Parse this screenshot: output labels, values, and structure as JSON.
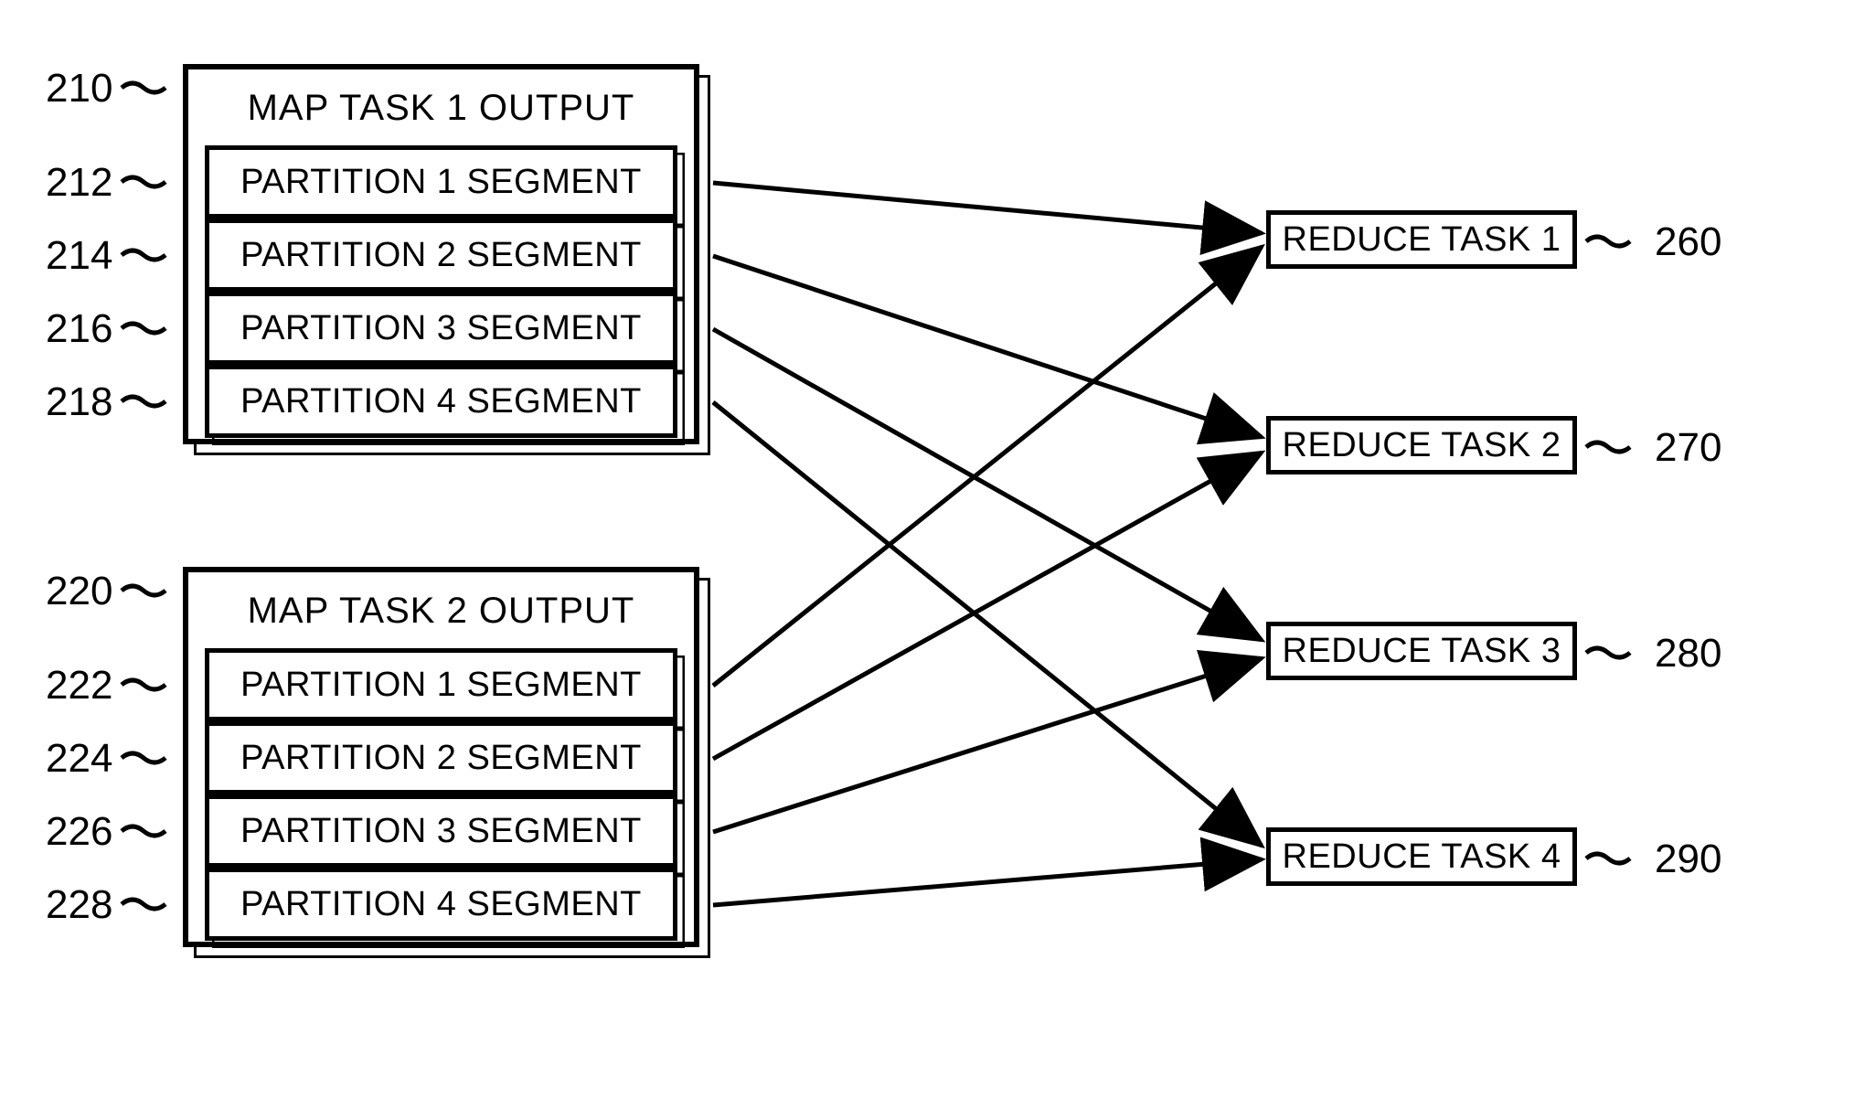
{
  "map_outputs": [
    {
      "title": "MAP TASK 1 OUTPUT",
      "ref": "210",
      "partitions": [
        {
          "label": "PARTITION 1 SEGMENT",
          "ref": "212"
        },
        {
          "label": "PARTITION 2 SEGMENT",
          "ref": "214"
        },
        {
          "label": "PARTITION 3 SEGMENT",
          "ref": "216"
        },
        {
          "label": "PARTITION 4 SEGMENT",
          "ref": "218"
        }
      ]
    },
    {
      "title": "MAP TASK 2 OUTPUT",
      "ref": "220",
      "partitions": [
        {
          "label": "PARTITION 1 SEGMENT",
          "ref": "222"
        },
        {
          "label": "PARTITION 2 SEGMENT",
          "ref": "224"
        },
        {
          "label": "PARTITION 3 SEGMENT",
          "ref": "226"
        },
        {
          "label": "PARTITION 4 SEGMENT",
          "ref": "228"
        }
      ]
    }
  ],
  "reduce_tasks": [
    {
      "label": "REDUCE TASK 1",
      "ref": "260"
    },
    {
      "label": "REDUCE TASK 2",
      "ref": "270"
    },
    {
      "label": "REDUCE TASK 3",
      "ref": "280"
    },
    {
      "label": "REDUCE TASK 4",
      "ref": "290"
    }
  ]
}
